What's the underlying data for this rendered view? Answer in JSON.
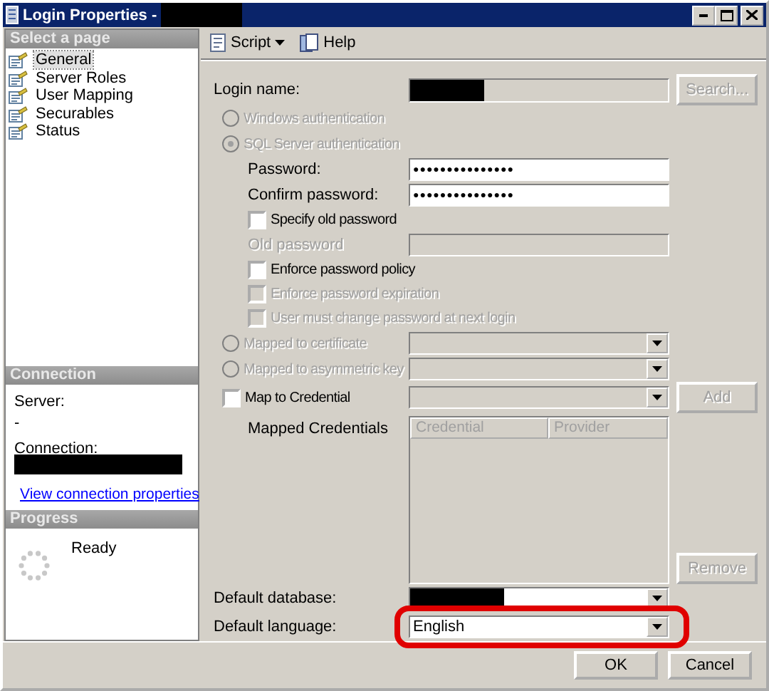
{
  "window": {
    "title": "Login Properties -",
    "title_redacted": true
  },
  "sidebar": {
    "header": "Select a page",
    "items": [
      {
        "label": "General",
        "selected": true
      },
      {
        "label": "Server Roles",
        "selected": false
      },
      {
        "label": "User Mapping",
        "selected": false
      },
      {
        "label": "Securables",
        "selected": false
      },
      {
        "label": "Status",
        "selected": false
      }
    ]
  },
  "connection": {
    "header": "Connection",
    "server_label": "Server:",
    "server_value": "-",
    "connection_label": "Connection:",
    "connection_redacted": true,
    "link": "View connection properties"
  },
  "progress": {
    "header": "Progress",
    "status": "Ready"
  },
  "toolbar": [
    {
      "label": "Script",
      "kind": "dropdown"
    },
    {
      "label": "Help",
      "kind": "help"
    }
  ],
  "form": [
    {
      "kind": "text",
      "label": "Login name:",
      "disabled": true,
      "redacted": true,
      "button": {
        "label": "Search...",
        "disabled": true
      }
    },
    {
      "kind": "radio",
      "label": "Windows authentication",
      "selected": false,
      "disabled": true
    },
    {
      "kind": "radio",
      "label": "SQL Server authentication",
      "selected": true,
      "disabled": true,
      "children": [
        {
          "kind": "password",
          "label": "Password:",
          "value": "●●●●●●●●●●●●●●●",
          "disabled": false
        },
        {
          "kind": "password",
          "label": "Confirm password:",
          "value": "●●●●●●●●●●●●●●●",
          "disabled": false
        },
        {
          "kind": "checkbox",
          "label": "Specify old password",
          "checked": false,
          "disabled": false
        },
        {
          "kind": "password",
          "label": "Old password",
          "disabled": true
        },
        {
          "kind": "checkbox",
          "label": "Enforce password policy",
          "checked": false,
          "disabled": false
        },
        {
          "kind": "checkbox",
          "label": "Enforce password expiration",
          "checked": false,
          "disabled": true
        },
        {
          "kind": "checkbox",
          "label": "User must change password at next login",
          "checked": false,
          "disabled": true
        }
      ]
    },
    {
      "kind": "radio",
      "label": "Mapped to certificate",
      "selected": false,
      "disabled": true,
      "combo": {
        "disabled": true
      }
    },
    {
      "kind": "radio",
      "label": "Mapped to asymmetric key",
      "selected": false,
      "disabled": true,
      "combo": {
        "disabled": true
      }
    },
    {
      "kind": "checkbox",
      "label": "Map to Credential",
      "checked": false,
      "disabled": false,
      "combo": {
        "disabled": true
      },
      "button": {
        "label": "Add",
        "disabled": true
      }
    },
    {
      "kind": "grid",
      "label": "Mapped Credentials",
      "columns": [
        "Credential",
        "Provider"
      ],
      "button": {
        "label": "Remove",
        "disabled": true
      }
    },
    {
      "kind": "combo",
      "label": "Default database:",
      "disabled": false,
      "redacted": true
    },
    {
      "kind": "combo",
      "label": "Default language:",
      "value": "English",
      "disabled": false,
      "highlighted": true
    }
  ],
  "buttons": [
    "OK",
    "Cancel"
  ]
}
